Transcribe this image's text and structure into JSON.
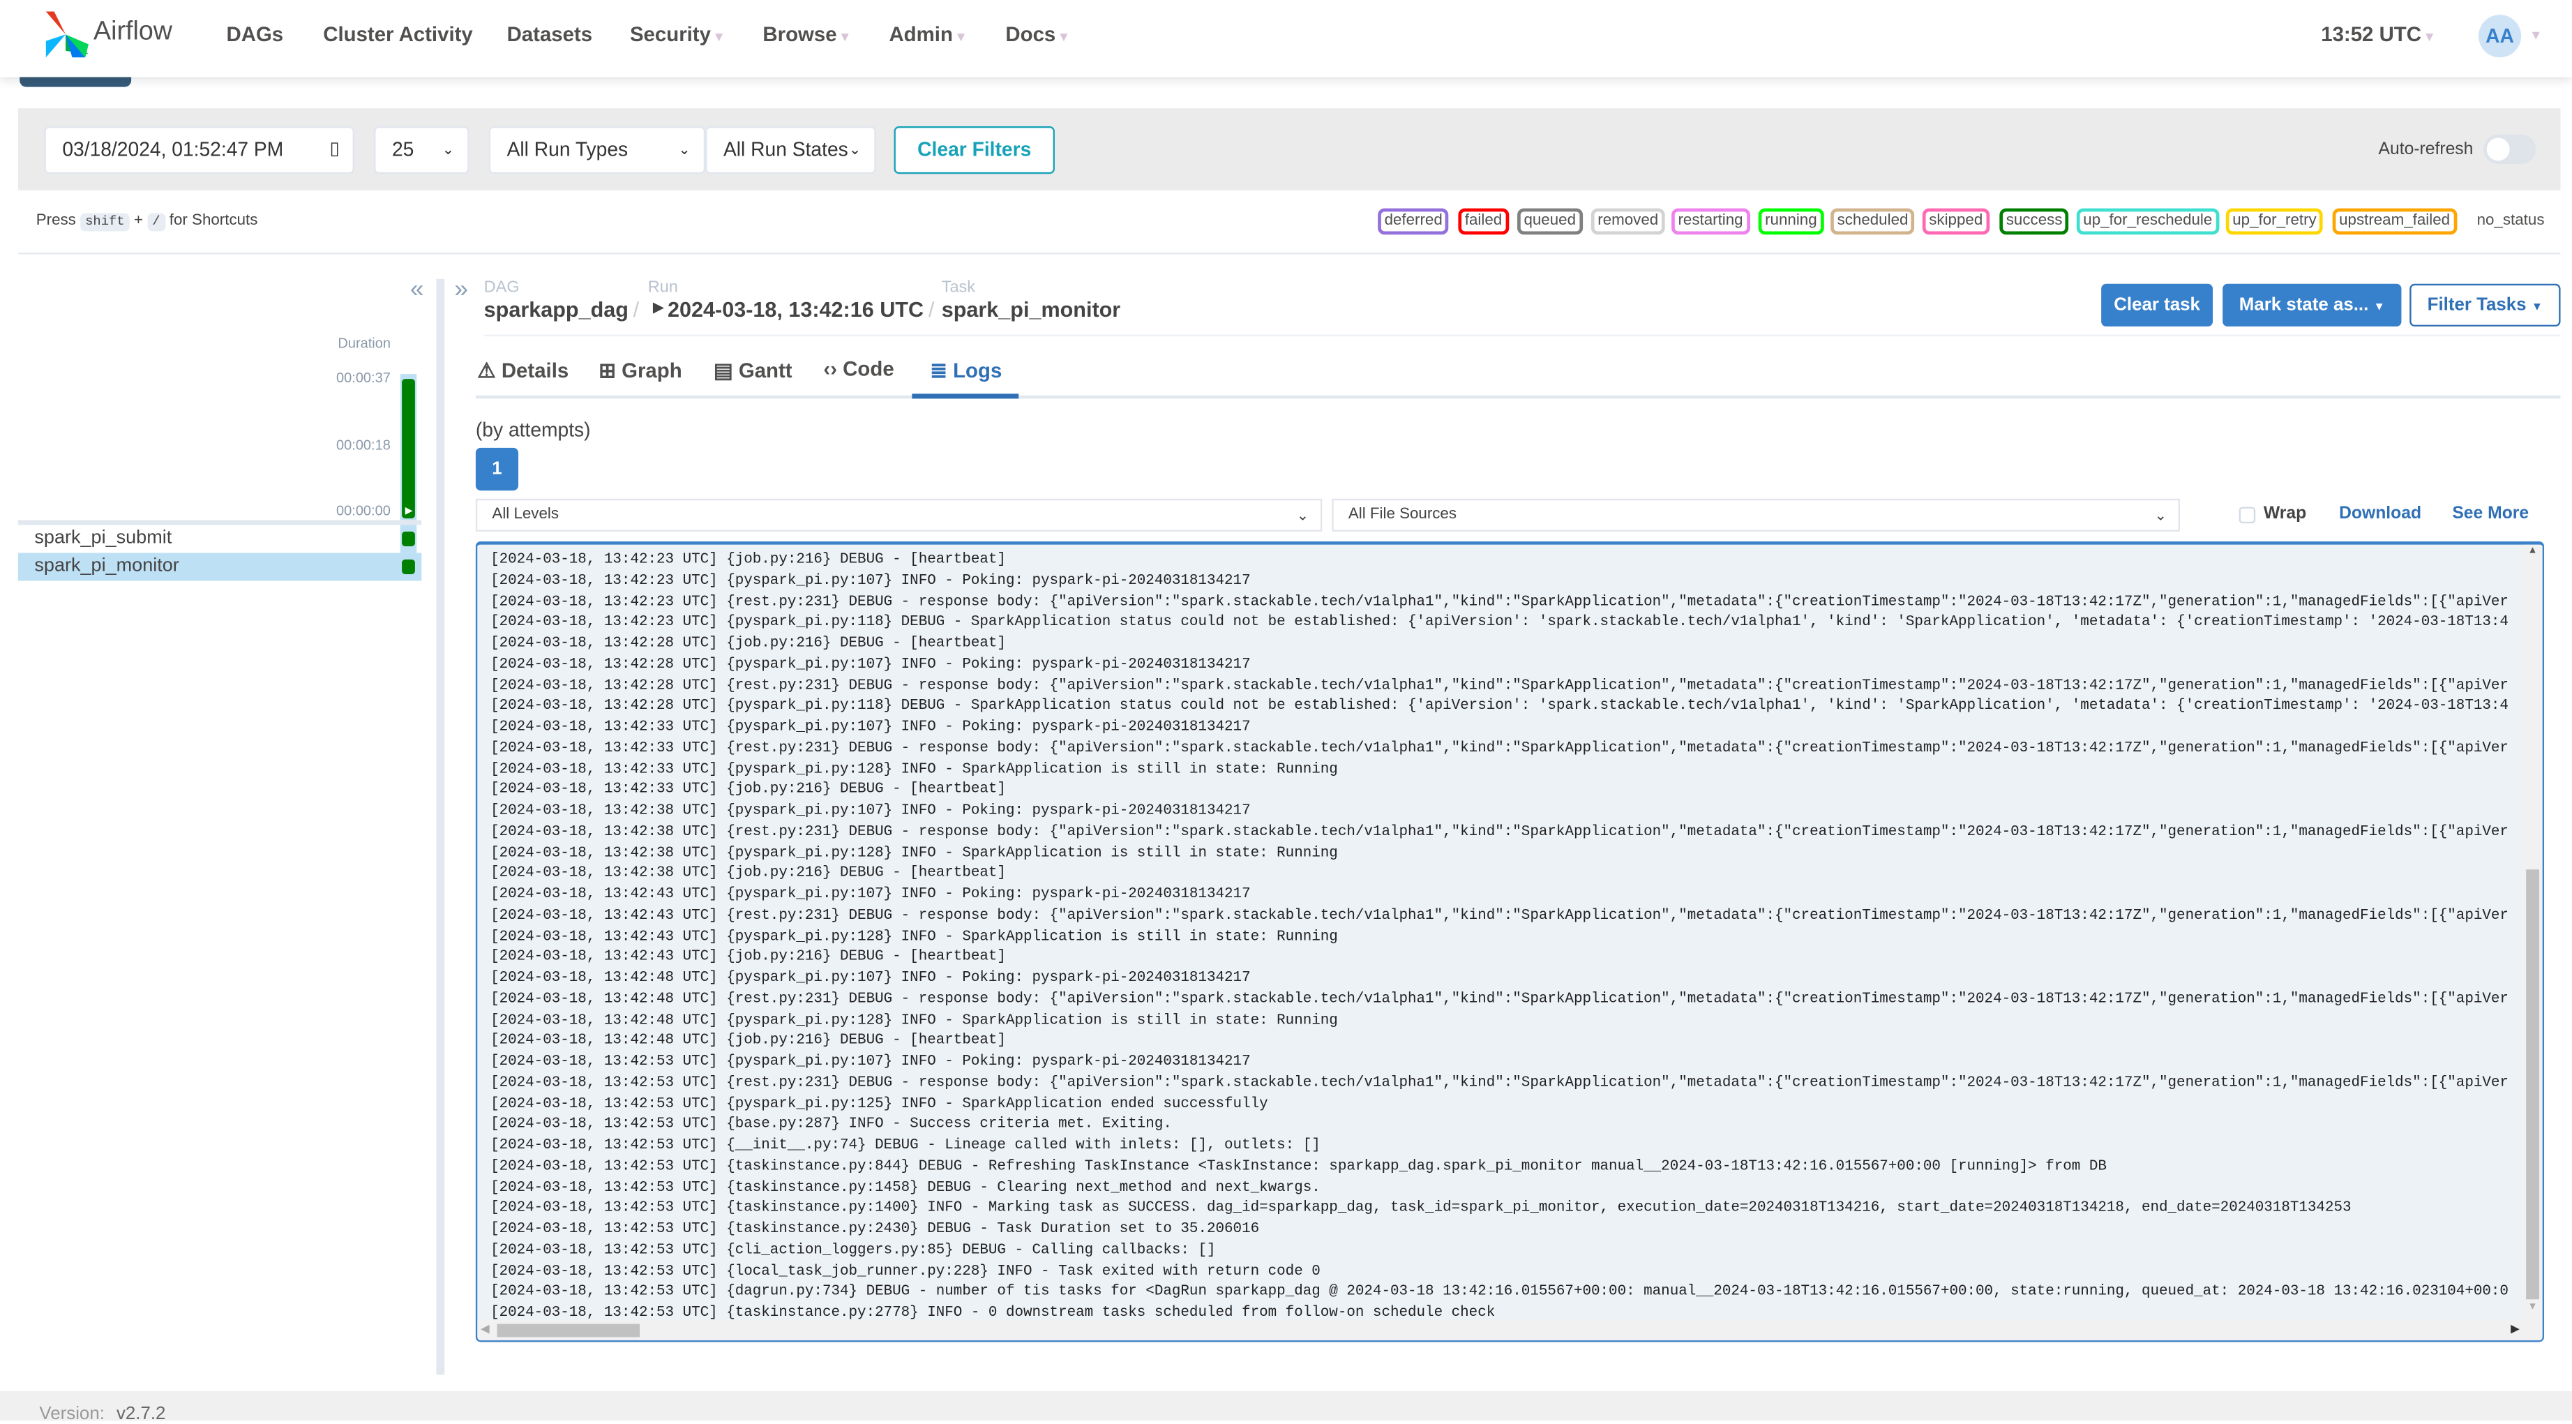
{
  "nav": {
    "brand": "Airflow",
    "items": [
      {
        "label": "DAGs",
        "dropdown": false
      },
      {
        "label": "Cluster Activity",
        "dropdown": false
      },
      {
        "label": "Datasets",
        "dropdown": false
      },
      {
        "label": "Security",
        "dropdown": true
      },
      {
        "label": "Browse",
        "dropdown": true
      },
      {
        "label": "Admin",
        "dropdown": true
      },
      {
        "label": "Docs",
        "dropdown": true
      }
    ],
    "time": "13:52 UTC",
    "avatar": "AA"
  },
  "filters": {
    "date": "03/18/2024, 01:52:47 PM",
    "num_runs": "25",
    "run_types": "All Run Types",
    "run_states": "All Run States",
    "clear": "Clear Filters",
    "auto_refresh": "Auto-refresh",
    "auto_refresh_on": false
  },
  "shortcuts": {
    "press": "Press",
    "key1": "shift",
    "plus": "+",
    "key2": "/",
    "suffix": "for Shortcuts"
  },
  "legend": [
    {
      "label": "deferred",
      "color": "#9370db"
    },
    {
      "label": "failed",
      "color": "#ff0000"
    },
    {
      "label": "queued",
      "color": "#808080"
    },
    {
      "label": "removed",
      "color": "#d3d3d3"
    },
    {
      "label": "restarting",
      "color": "#ee82ee"
    },
    {
      "label": "running",
      "color": "#00ff00"
    },
    {
      "label": "scheduled",
      "color": "#d2b48c"
    },
    {
      "label": "skipped",
      "color": "#ff69b4"
    },
    {
      "label": "success",
      "color": "#008000"
    },
    {
      "label": "up_for_reschedule",
      "color": "#40e0d0"
    },
    {
      "label": "up_for_retry",
      "color": "#ffd700"
    },
    {
      "label": "upstream_failed",
      "color": "#ffa500"
    },
    {
      "label": "no_status",
      "color": ""
    }
  ],
  "grid": {
    "duration_label": "Duration",
    "ticks": [
      "00:00:37",
      "00:00:18",
      "00:00:00"
    ],
    "tasks": [
      {
        "name": "spark_pi_submit",
        "state": "success",
        "selected": false
      },
      {
        "name": "spark_pi_monitor",
        "state": "success",
        "selected": true
      }
    ]
  },
  "breadcrumb": {
    "dag_label": "DAG",
    "dag": "sparkapp_dag",
    "run_label": "Run",
    "run": "2024-03-18, 13:42:16 UTC",
    "task_label": "Task",
    "task": "spark_pi_monitor"
  },
  "actions": {
    "clear_task": "Clear task",
    "mark_state": "Mark state as...",
    "filter_tasks": "Filter Tasks"
  },
  "tabs": [
    {
      "label": "Details",
      "icon": "warning-triangle-icon"
    },
    {
      "label": "Graph",
      "icon": "graph-icon"
    },
    {
      "label": "Gantt",
      "icon": "gantt-icon"
    },
    {
      "label": "Code",
      "icon": "code-icon"
    },
    {
      "label": "Logs",
      "icon": "list-icon",
      "active": true
    }
  ],
  "logs": {
    "by_attempts": "(by attempts)",
    "attempt": "1",
    "levels": "All Levels",
    "sources": "All File Sources",
    "wrap": "Wrap",
    "wrap_checked": false,
    "download": "Download",
    "see_more": "See More",
    "lines": [
      "[2024-03-18, 13:42:23 UTC] {job.py:216} DEBUG - [heartbeat]",
      "[2024-03-18, 13:42:23 UTC] {pyspark_pi.py:107} INFO - Poking: pyspark-pi-20240318134217",
      "[2024-03-18, 13:42:23 UTC] {rest.py:231} DEBUG - response body: {\"apiVersion\":\"spark.stackable.tech/v1alpha1\",\"kind\":\"SparkApplication\",\"metadata\":{\"creationTimestamp\":\"2024-03-18T13:42:17Z\",\"generation\":1,\"managedFields\":[{\"apiVer",
      "[2024-03-18, 13:42:23 UTC] {pyspark_pi.py:118} DEBUG - SparkApplication status could not be established: {'apiVersion': 'spark.stackable.tech/v1alpha1', 'kind': 'SparkApplication', 'metadata': {'creationTimestamp': '2024-03-18T13:4",
      "[2024-03-18, 13:42:28 UTC] {job.py:216} DEBUG - [heartbeat]",
      "[2024-03-18, 13:42:28 UTC] {pyspark_pi.py:107} INFO - Poking: pyspark-pi-20240318134217",
      "[2024-03-18, 13:42:28 UTC] {rest.py:231} DEBUG - response body: {\"apiVersion\":\"spark.stackable.tech/v1alpha1\",\"kind\":\"SparkApplication\",\"metadata\":{\"creationTimestamp\":\"2024-03-18T13:42:17Z\",\"generation\":1,\"managedFields\":[{\"apiVer",
      "[2024-03-18, 13:42:28 UTC] {pyspark_pi.py:118} DEBUG - SparkApplication status could not be established: {'apiVersion': 'spark.stackable.tech/v1alpha1', 'kind': 'SparkApplication', 'metadata': {'creationTimestamp': '2024-03-18T13:4",
      "[2024-03-18, 13:42:33 UTC] {pyspark_pi.py:107} INFO - Poking: pyspark-pi-20240318134217",
      "[2024-03-18, 13:42:33 UTC] {rest.py:231} DEBUG - response body: {\"apiVersion\":\"spark.stackable.tech/v1alpha1\",\"kind\":\"SparkApplication\",\"metadata\":{\"creationTimestamp\":\"2024-03-18T13:42:17Z\",\"generation\":1,\"managedFields\":[{\"apiVer",
      "[2024-03-18, 13:42:33 UTC] {pyspark_pi.py:128} INFO - SparkApplication is still in state: Running",
      "[2024-03-18, 13:42:33 UTC] {job.py:216} DEBUG - [heartbeat]",
      "[2024-03-18, 13:42:38 UTC] {pyspark_pi.py:107} INFO - Poking: pyspark-pi-20240318134217",
      "[2024-03-18, 13:42:38 UTC] {rest.py:231} DEBUG - response body: {\"apiVersion\":\"spark.stackable.tech/v1alpha1\",\"kind\":\"SparkApplication\",\"metadata\":{\"creationTimestamp\":\"2024-03-18T13:42:17Z\",\"generation\":1,\"managedFields\":[{\"apiVer",
      "[2024-03-18, 13:42:38 UTC] {pyspark_pi.py:128} INFO - SparkApplication is still in state: Running",
      "[2024-03-18, 13:42:38 UTC] {job.py:216} DEBUG - [heartbeat]",
      "[2024-03-18, 13:42:43 UTC] {pyspark_pi.py:107} INFO - Poking: pyspark-pi-20240318134217",
      "[2024-03-18, 13:42:43 UTC] {rest.py:231} DEBUG - response body: {\"apiVersion\":\"spark.stackable.tech/v1alpha1\",\"kind\":\"SparkApplication\",\"metadata\":{\"creationTimestamp\":\"2024-03-18T13:42:17Z\",\"generation\":1,\"managedFields\":[{\"apiVer",
      "[2024-03-18, 13:42:43 UTC] {pyspark_pi.py:128} INFO - SparkApplication is still in state: Running",
      "[2024-03-18, 13:42:43 UTC] {job.py:216} DEBUG - [heartbeat]",
      "[2024-03-18, 13:42:48 UTC] {pyspark_pi.py:107} INFO - Poking: pyspark-pi-20240318134217",
      "[2024-03-18, 13:42:48 UTC] {rest.py:231} DEBUG - response body: {\"apiVersion\":\"spark.stackable.tech/v1alpha1\",\"kind\":\"SparkApplication\",\"metadata\":{\"creationTimestamp\":\"2024-03-18T13:42:17Z\",\"generation\":1,\"managedFields\":[{\"apiVer",
      "[2024-03-18, 13:42:48 UTC] {pyspark_pi.py:128} INFO - SparkApplication is still in state: Running",
      "[2024-03-18, 13:42:48 UTC] {job.py:216} DEBUG - [heartbeat]",
      "[2024-03-18, 13:42:53 UTC] {pyspark_pi.py:107} INFO - Poking: pyspark-pi-20240318134217",
      "[2024-03-18, 13:42:53 UTC] {rest.py:231} DEBUG - response body: {\"apiVersion\":\"spark.stackable.tech/v1alpha1\",\"kind\":\"SparkApplication\",\"metadata\":{\"creationTimestamp\":\"2024-03-18T13:42:17Z\",\"generation\":1,\"managedFields\":[{\"apiVer",
      "[2024-03-18, 13:42:53 UTC] {pyspark_pi.py:125} INFO - SparkApplication ended successfully",
      "[2024-03-18, 13:42:53 UTC] {base.py:287} INFO - Success criteria met. Exiting.",
      "[2024-03-18, 13:42:53 UTC] {__init__.py:74} DEBUG - Lineage called with inlets: [], outlets: []",
      "[2024-03-18, 13:42:53 UTC] {taskinstance.py:844} DEBUG - Refreshing TaskInstance <TaskInstance: sparkapp_dag.spark_pi_monitor manual__2024-03-18T13:42:16.015567+00:00 [running]> from DB",
      "[2024-03-18, 13:42:53 UTC] {taskinstance.py:1458} DEBUG - Clearing next_method and next_kwargs.",
      "[2024-03-18, 13:42:53 UTC] {taskinstance.py:1400} INFO - Marking task as SUCCESS. dag_id=sparkapp_dag, task_id=spark_pi_monitor, execution_date=20240318T134216, start_date=20240318T134218, end_date=20240318T134253",
      "[2024-03-18, 13:42:53 UTC] {taskinstance.py:2430} DEBUG - Task Duration set to 35.206016",
      "[2024-03-18, 13:42:53 UTC] {cli_action_loggers.py:85} DEBUG - Calling callbacks: []",
      "[2024-03-18, 13:42:53 UTC] {local_task_job_runner.py:228} INFO - Task exited with return code 0",
      "[2024-03-18, 13:42:53 UTC] {dagrun.py:734} DEBUG - number of tis tasks for <DagRun sparkapp_dag @ 2024-03-18 13:42:16.015567+00:00: manual__2024-03-18T13:42:16.015567+00:00, state:running, queued_at: 2024-03-18 13:42:16.023104+00:0",
      "[2024-03-18, 13:42:53 UTC] {taskinstance.py:2778} INFO - 0 downstream tasks scheduled from follow-on schedule check"
    ]
  },
  "footer": {
    "version_label": "Version:",
    "version": "v2.7.2"
  },
  "colors": {
    "primary": "#3780cb",
    "success": "#008000",
    "selected_row": "#bee0f5"
  }
}
